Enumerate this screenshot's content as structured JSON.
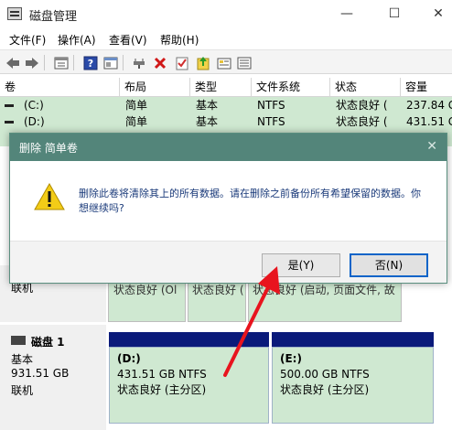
{
  "window": {
    "title": "磁盘管理",
    "min": "—",
    "max": "☐",
    "close": "✕"
  },
  "menu": [
    "文件(F)",
    "操作(A)",
    "查看(V)",
    "帮助(H)"
  ],
  "toolbar_icons": [
    "back-icon",
    "forward-icon",
    "properties-icon",
    "help-icon",
    "console-icon",
    "connect-icon",
    "delete-icon",
    "checklist-icon",
    "import-icon",
    "drive-info-icon"
  ],
  "volumes": {
    "headers": [
      "卷",
      "布局",
      "类型",
      "文件系统",
      "状态",
      "容量"
    ],
    "rows": [
      {
        "name": "(C:)",
        "layout": "简单",
        "type": "基本",
        "fs": "NTFS",
        "status": "状态良好 (",
        "capacity": "237.84 G"
      },
      {
        "name": "(D:)",
        "layout": "简单",
        "type": "基本",
        "fs": "NTFS",
        "status": "状态良好 (",
        "capacity": "431.51 G"
      }
    ]
  },
  "disk0": {
    "status_left": "联机",
    "partitions": [
      {
        "status": "状态良好 (Ol"
      },
      {
        "status": "状态良好 ("
      },
      {
        "status": "状态良好 (启动, 页面文件, 故"
      }
    ]
  },
  "disk1": {
    "name": "磁盘 1",
    "type": "基本",
    "size": "931.51 GB",
    "status": "联机",
    "partitions": [
      {
        "label": "(D:)",
        "size": "431.51 GB NTFS",
        "status": "状态良好 (主分区)"
      },
      {
        "label": "(E:)",
        "size": "500.00 GB NTFS",
        "status": "状态良好 (主分区)"
      }
    ]
  },
  "dialog": {
    "title": "删除 简单卷",
    "close": "✕",
    "message": "删除此卷将清除其上的所有数据。请在删除之前备份所有希望保留的数据。你想继续吗?",
    "yes": "是(Y)",
    "no": "否(N)"
  },
  "colors": {
    "dialog_title_bg": "#53857a",
    "volume_row_bg": "#cfe8d1",
    "partition_bar": "#0a1a7a",
    "arrow": "#e8141e"
  }
}
